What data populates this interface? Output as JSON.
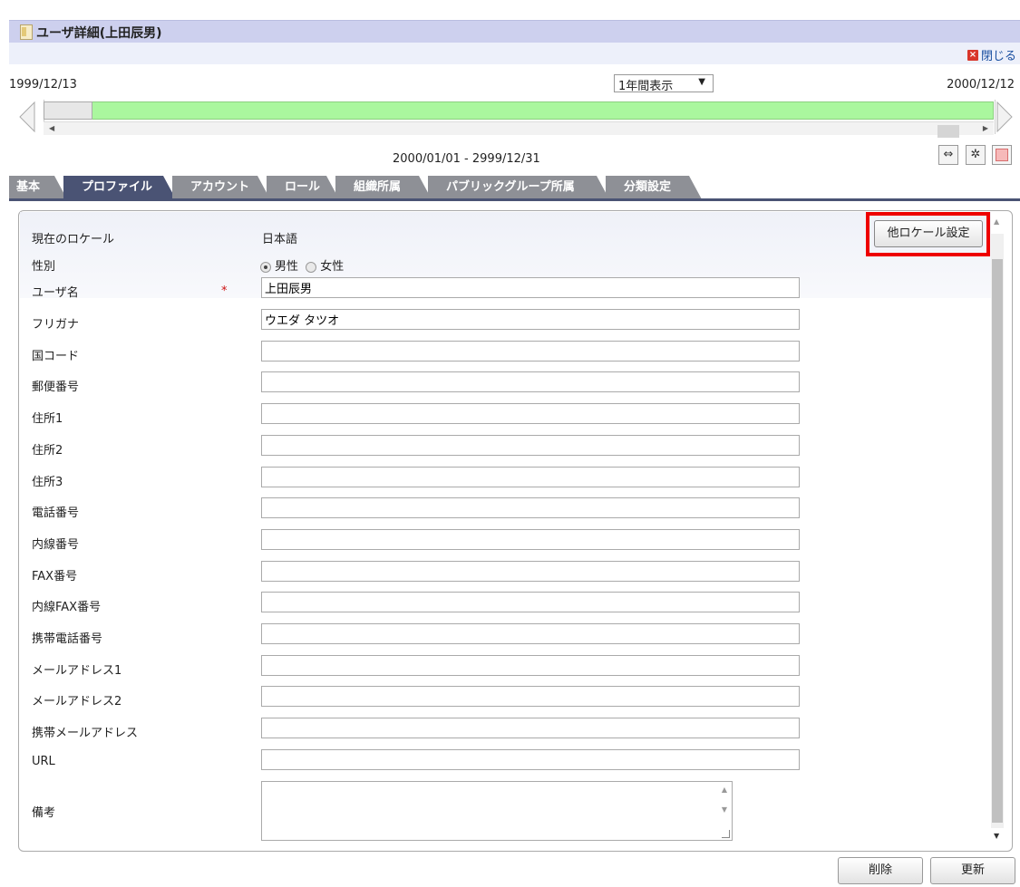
{
  "window": {
    "title": "ユーザ詳細(上田辰男)",
    "close_label": "閉じる"
  },
  "timeline": {
    "start_date": "1999/12/13",
    "end_date": "2000/12/12",
    "view_select": "1年間表示",
    "period": "2000/01/01 - 2999/12/31"
  },
  "tabs": [
    {
      "label": "基本",
      "active": false
    },
    {
      "label": "プロファイル",
      "active": true
    },
    {
      "label": "アカウント",
      "active": false
    },
    {
      "label": "ロール",
      "active": false
    },
    {
      "label": "組織所属",
      "active": false
    },
    {
      "label": "パブリックグループ所属",
      "active": false
    },
    {
      "label": "分類設定",
      "active": false
    }
  ],
  "profile": {
    "locale_label": "現在のロケール",
    "locale_value": "日本語",
    "other_locale_button": "他ロケール設定",
    "gender_label": "性別",
    "gender_options": [
      "男性",
      "女性"
    ],
    "gender_selected": "男性",
    "required_mark": "*",
    "fields": [
      {
        "label": "ユーザ名",
        "value": "上田辰男",
        "required": true
      },
      {
        "label": "フリガナ",
        "value": "ウエダ タツオ"
      },
      {
        "label": "国コード",
        "value": ""
      },
      {
        "label": "郵便番号",
        "value": ""
      },
      {
        "label": "住所1",
        "value": ""
      },
      {
        "label": "住所2",
        "value": ""
      },
      {
        "label": "住所3",
        "value": ""
      },
      {
        "label": "電話番号",
        "value": ""
      },
      {
        "label": "内線番号",
        "value": ""
      },
      {
        "label": "FAX番号",
        "value": ""
      },
      {
        "label": "内線FAX番号",
        "value": ""
      },
      {
        "label": "携帯電話番号",
        "value": ""
      },
      {
        "label": "メールアドレス1",
        "value": ""
      },
      {
        "label": "メールアドレス2",
        "value": ""
      },
      {
        "label": "携帯メールアドレス",
        "value": ""
      },
      {
        "label": "URL",
        "value": ""
      }
    ],
    "remarks_label": "備考",
    "remarks_value": ""
  },
  "buttons": {
    "delete": "削除",
    "update": "更新"
  },
  "colors": {
    "header_bg": "#cdd0ee",
    "active_tab": "#4a5374",
    "inactive_tab": "#8e9096",
    "timeline_bar": "#aaf79e",
    "highlight": "#e00000"
  }
}
